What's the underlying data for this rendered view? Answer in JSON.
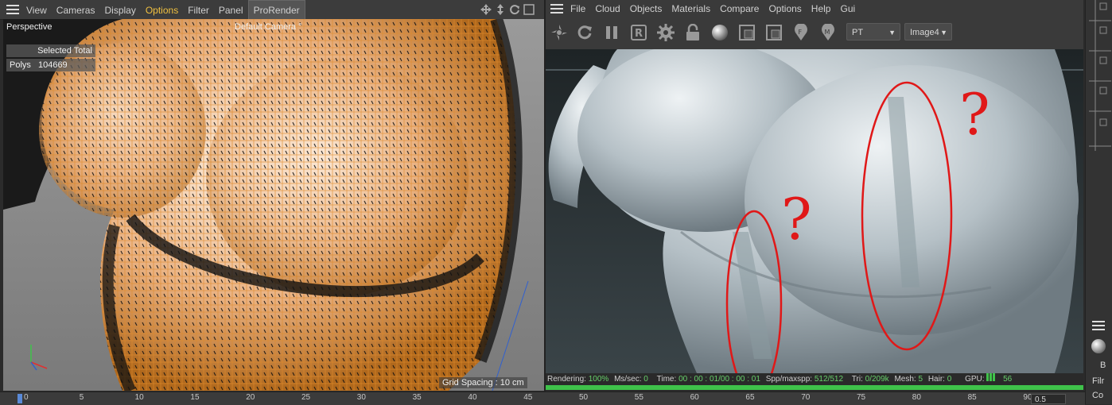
{
  "left_menu": {
    "items": [
      "View",
      "Cameras",
      "Display",
      "Options",
      "Filter",
      "Panel",
      "ProRender"
    ]
  },
  "viewport": {
    "view_name": "Perspective",
    "camera_name": "Default Camera",
    "camera_suffix": "°",
    "stats_header": "Selected Total",
    "polys_label": "Polys",
    "polys_value": "104669",
    "grid_spacing": "Grid Spacing : 10 cm"
  },
  "right_menu": {
    "items": [
      "File",
      "Cloud",
      "Objects",
      "Materials",
      "Compare",
      "Options",
      "Help",
      "Gui"
    ]
  },
  "toolbar": {
    "mode_select": "PT",
    "image_select": "Image4"
  },
  "status": {
    "rendering_label": "Rendering:",
    "rendering_value": "100%",
    "ms_label": "Ms/sec:",
    "ms_value": "0",
    "time_label": "Time:",
    "time_value": "00 : 00 : 01/00 : 00 : 01",
    "spp_label": "Spp/maxspp:",
    "spp_value": "512/512",
    "tri_label": "Tri:",
    "tri_value": "0/209k",
    "mesh_label": "Mesh:",
    "mesh_value": "5",
    "hair_label": "Hair:",
    "hair_value": "0",
    "gpu_label": "GPU:",
    "gpu_value": "56"
  },
  "progress": {
    "fraction": 1.0
  },
  "timeline": {
    "ticks": [
      "0",
      "5",
      "10",
      "15",
      "20",
      "25",
      "30",
      "35",
      "40",
      "45",
      "50",
      "55",
      "60",
      "65",
      "70",
      "75",
      "80",
      "85",
      "90"
    ],
    "field_value": "0.5"
  },
  "side_panel": {
    "labels": [
      "B",
      "Filr",
      "Co"
    ]
  },
  "annotations": {
    "marks": [
      "?",
      "?"
    ]
  },
  "colors": {
    "accent_orange": "#f0c040",
    "progress_green": "#3fc24a",
    "annotation_red": "#e01818"
  }
}
